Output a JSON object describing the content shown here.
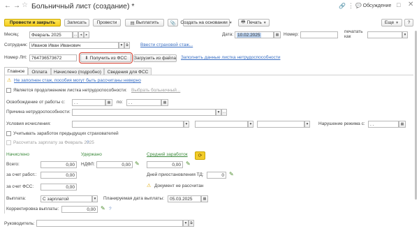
{
  "window": {
    "title": "Больничный лист (создание) *",
    "discussion": "Обсуждение"
  },
  "toolbar": {
    "post_close": "Провести и закрыть",
    "save": "Записать",
    "post": "Провести",
    "pay": "Выплатить",
    "create_based": "Создать на основании",
    "print": "Печать",
    "more": "Еще",
    "help": "?"
  },
  "form": {
    "month_label": "Месяц:",
    "month_value": "Февраль 2025",
    "date_label": "Дата:",
    "date_value": "10.02.2025",
    "number_label": "Номер:",
    "print_as_label": "печатать как",
    "employee_label": "Сотрудник:",
    "employee_value": "Иванов Иван Иванович",
    "enter_insurance_link": "Ввести страховой стаж...",
    "sick_number_label": "Номер ЛН:",
    "sick_number_value": "764736573672",
    "get_fss": "Получить из ФСС",
    "load_file": "Загрузить из файла",
    "fill_data_link": "Заполнить данные листка нетрудоспособности"
  },
  "tabs": [
    {
      "label": "Главное"
    },
    {
      "label": "Оплата"
    },
    {
      "label": "Начислено (подробно)"
    },
    {
      "label": "Сведения для ФСС"
    }
  ],
  "main": {
    "warning_link": "Не заполнен стаж, пособия могут быть рассчитаны неверно",
    "continuation_label": "Является продолжением листка нетрудоспособности:",
    "choose_sick_link": "Выбрать больничный...",
    "release_label": "Освобождение от работы с:",
    "release_from": " .  .",
    "release_to_label": "по:",
    "release_to": " .  .",
    "cause_label": "Причина нетрудоспособности:",
    "conditions_label": "Условия исчисления:",
    "violation_label": "Нарушение режима с:",
    "violation_value": " .  .",
    "consider_previous": "Учитывать заработок предыдущих страхователей",
    "calc_salary": "Рассчитать зарплату за Февраль 2025"
  },
  "accrual": {
    "accrued_header": "Начислено",
    "withheld_header": "Удержано",
    "avg_header": "Средний заработок",
    "total_label": "Всего:",
    "total_value": "0,00",
    "ndfl_label": "НДФЛ:",
    "ndfl_value": "0,00",
    "avg_value": "0,00",
    "employer_label": "за счет работ.:",
    "employer_value": "0,00",
    "suspension_label": "Дней приостановления ТД:",
    "suspension_value": "0",
    "fss_label": "за счет ФСС:",
    "fss_value": "0,00",
    "doc_not_calc": "Документ не рассчитан",
    "payment_label": "Выплата:",
    "payment_value": "С зарплатой",
    "planned_date_label": "Планируемая дата выплаты:",
    "planned_date_value": "05.03.2025",
    "correction_label": "Корректировка выплаты:",
    "correction_value": "0,00"
  },
  "footer": {
    "manager_label": "Руководитель:"
  }
}
